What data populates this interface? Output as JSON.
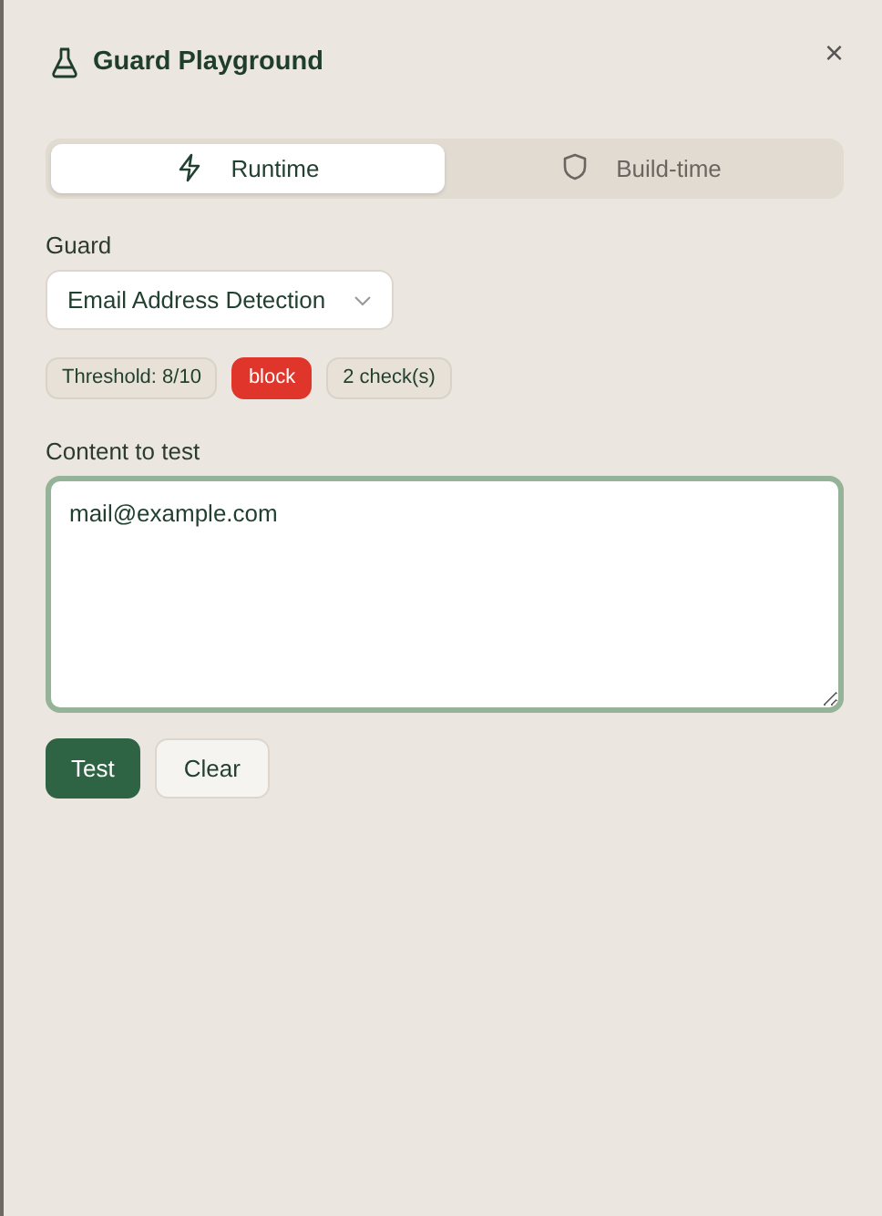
{
  "header": {
    "title": "Guard Playground",
    "close": "×"
  },
  "tabs": [
    {
      "label": "Runtime",
      "selected": true
    },
    {
      "label": "Build-time",
      "selected": false
    }
  ],
  "guard": {
    "label": "Guard",
    "value": "Email Address Detection"
  },
  "badges": [
    {
      "text": "Threshold: 8/10",
      "kind": "info"
    },
    {
      "text": "block",
      "kind": "action"
    },
    {
      "text": "2 check(s)",
      "kind": "info"
    }
  ],
  "content": {
    "label": "Content to test",
    "value": "mail@example.com",
    "focused": true
  },
  "buttons": [
    {
      "label": "Test",
      "kind": "primary"
    },
    {
      "label": "Clear",
      "kind": "secondary"
    }
  ]
}
